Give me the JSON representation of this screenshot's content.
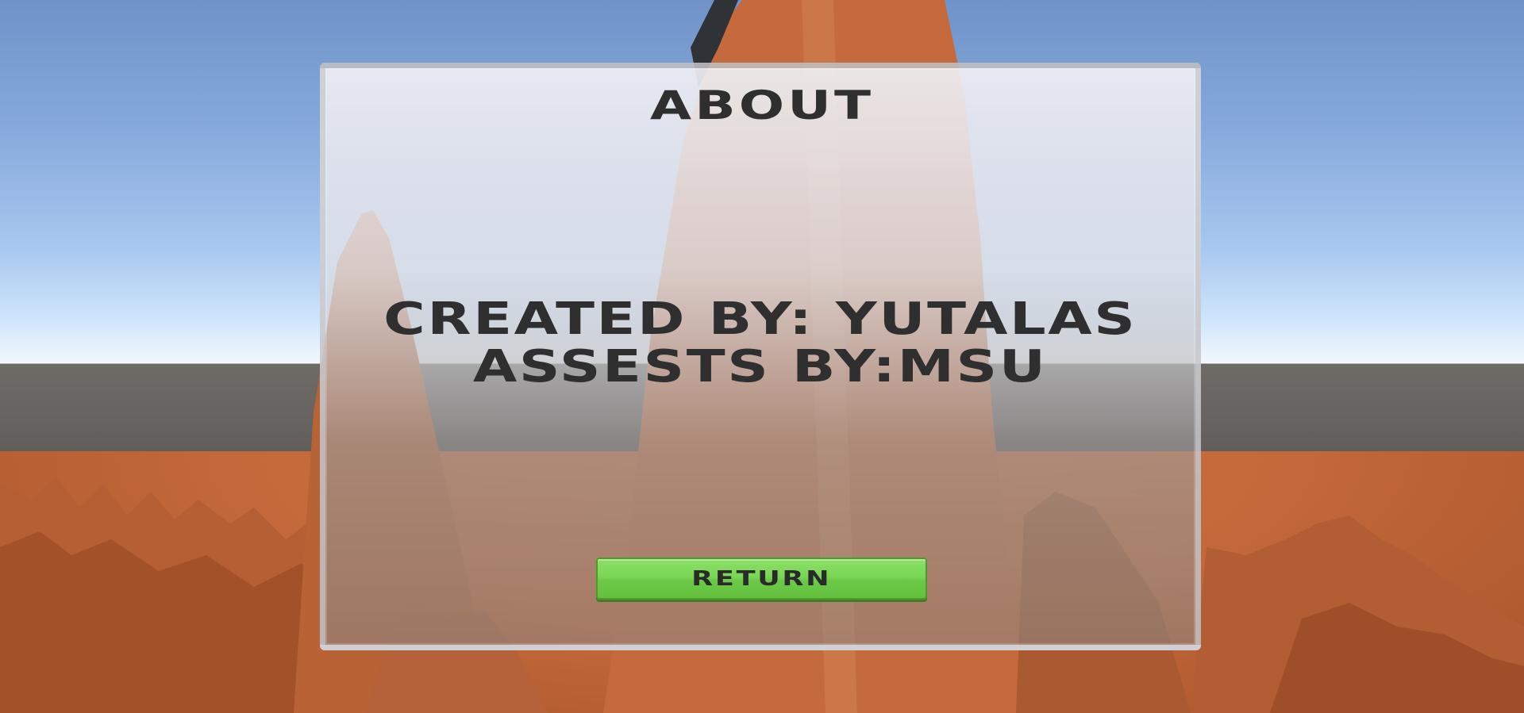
{
  "screen": "about",
  "panel": {
    "title": "ABOUT",
    "credits_line_1": "CREATED BY: YUTALAS",
    "credits_line_2": "ASSESTS BY:MSU"
  },
  "buttons": {
    "return_label": "RETURN"
  },
  "colors": {
    "text": "#2f2f2f",
    "button_green": "#7ad656",
    "sky": "#86a9dc",
    "ground": "#c56a3b"
  }
}
